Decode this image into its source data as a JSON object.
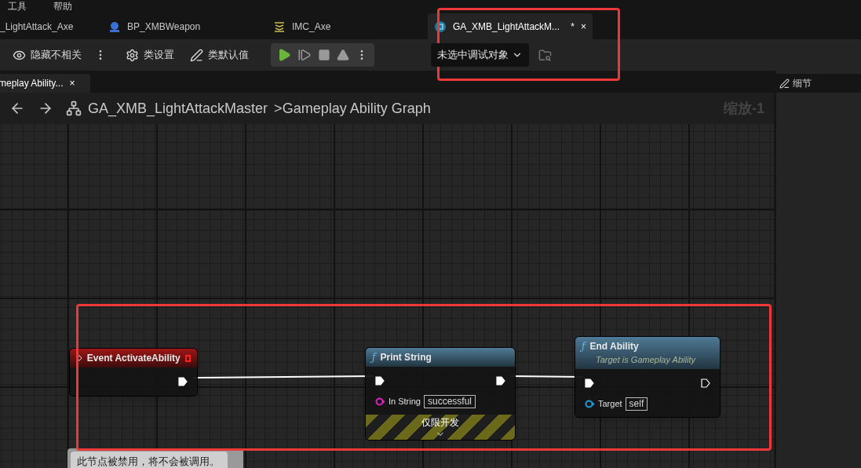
{
  "menu": [
    "工具",
    "帮助"
  ],
  "tabs": [
    {
      "label": "_LightAttack_Axe",
      "selected": false
    },
    {
      "label": "BP_XMBWeapon",
      "selected": false
    },
    {
      "label": "IMC_Axe",
      "selected": false
    },
    {
      "label": "GA_XMB_LightAttackM...",
      "selected": true,
      "modified_mark": "*",
      "close": "×"
    }
  ],
  "toolbar": {
    "items": [
      {
        "kind": "hide",
        "label": "隐藏不相关"
      },
      {
        "kind": "settings",
        "label": "类设置"
      },
      {
        "kind": "defaults",
        "label": "类默认值"
      }
    ],
    "debug_dropdown": "未选中调试对象"
  },
  "graph_tab": {
    "label": "meplay Ability...",
    "close": "×"
  },
  "breadcrumb": {
    "items": [
      "GA_XMB_LightAttackMaster",
      "Gameplay Ability Graph"
    ],
    "separator": ">",
    "zoom": "缩放-1"
  },
  "details_panel": {
    "title": "细节"
  },
  "nodes": [
    {
      "kind": "event",
      "title": "Event ActivateAbility",
      "exec_out": {
        "connected": true
      }
    },
    {
      "kind": "function",
      "glyph": "ƒ",
      "title": "Print String",
      "exec_in": {
        "connected": true
      },
      "exec_out": {
        "connected": true
      },
      "pins": [
        {
          "kind": "string",
          "label": "In String",
          "value": "successful"
        }
      ],
      "footer": "仅限开发"
    },
    {
      "kind": "function",
      "glyph": "ƒ",
      "title": "End Ability",
      "subtitle": "Target is Gameplay Ability",
      "exec_in": {
        "connected": true
      },
      "exec_out": {
        "connected": false
      },
      "pins": [
        {
          "kind": "object",
          "label": "Target",
          "value": "self"
        }
      ]
    }
  ],
  "comment": "此节点被禁用，将不会被调用。"
}
